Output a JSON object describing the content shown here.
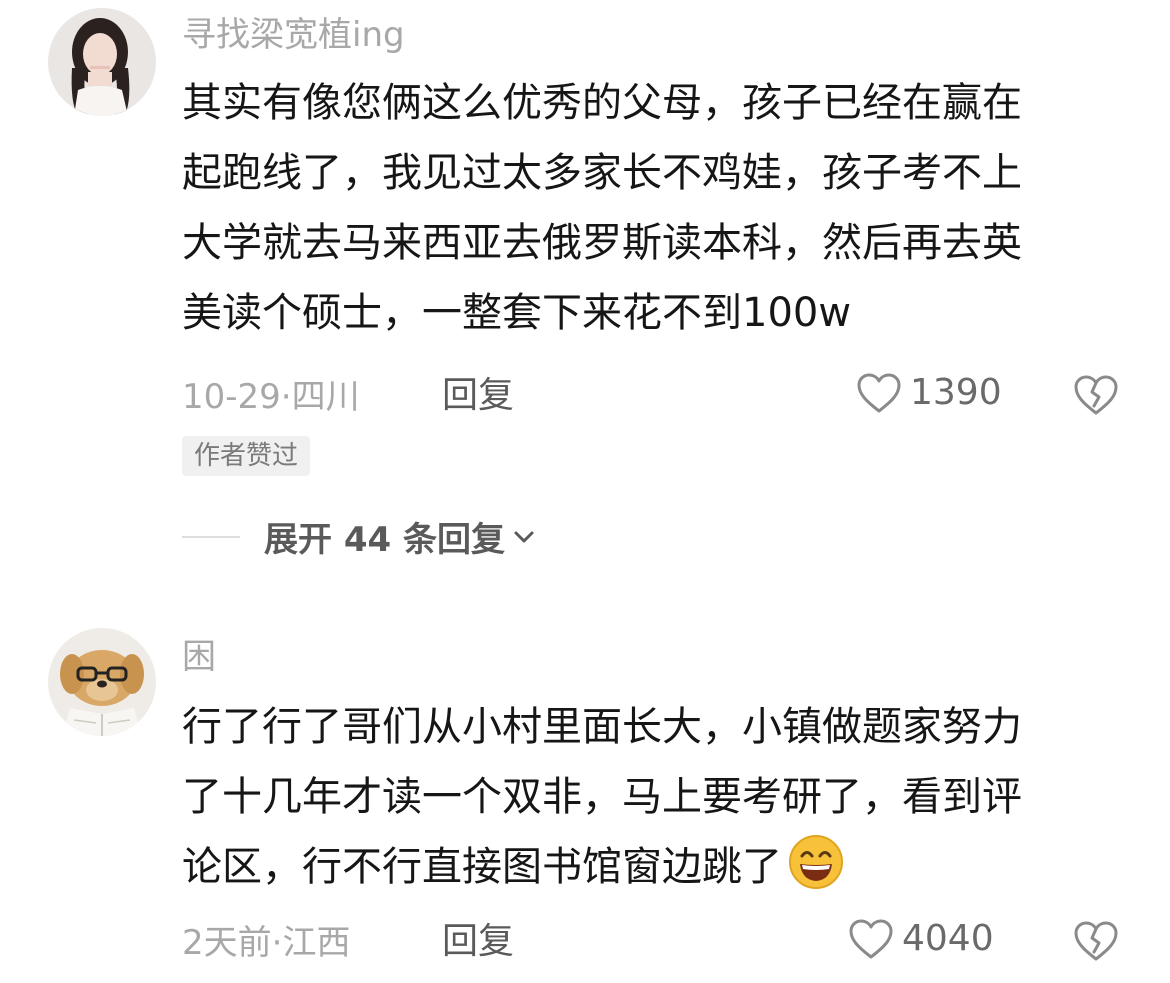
{
  "comments": [
    {
      "username": "寻找梁宽植ing",
      "avatar_icon": "user-avatar-girl",
      "lines": [
        "其实有像您俩这么优秀的父母，孩子已经在赢在",
        "起跑线了，我见过太多家长不鸡娃，孩子考不上",
        "大学就去马来西亚去俄罗斯读本科，然后再去英",
        "美读个硕士，一整套下来花不到100w"
      ],
      "meta": "10-29·四川",
      "reply_label": "回复",
      "likes": "1390",
      "badge": "作者赞过",
      "expand_label": "展开 44 条回复"
    },
    {
      "username": "困",
      "avatar_icon": "dog-with-glasses-avatar",
      "lines": [
        "行了行了哥们从小村里面长大，小镇做题家努力",
        "了十几年才读一个双非，马上要考研了，看到评",
        "论区，行不行直接图书馆窗边跳了"
      ],
      "emoji": "grinning-face-emoji",
      "meta": "2天前·江西",
      "reply_label": "回复",
      "likes": "4040"
    }
  ],
  "colors": {
    "username": "#a8a8a8",
    "text": "#161616",
    "meta": "#a8a8a8",
    "badge_bg": "#f0f0f0"
  }
}
